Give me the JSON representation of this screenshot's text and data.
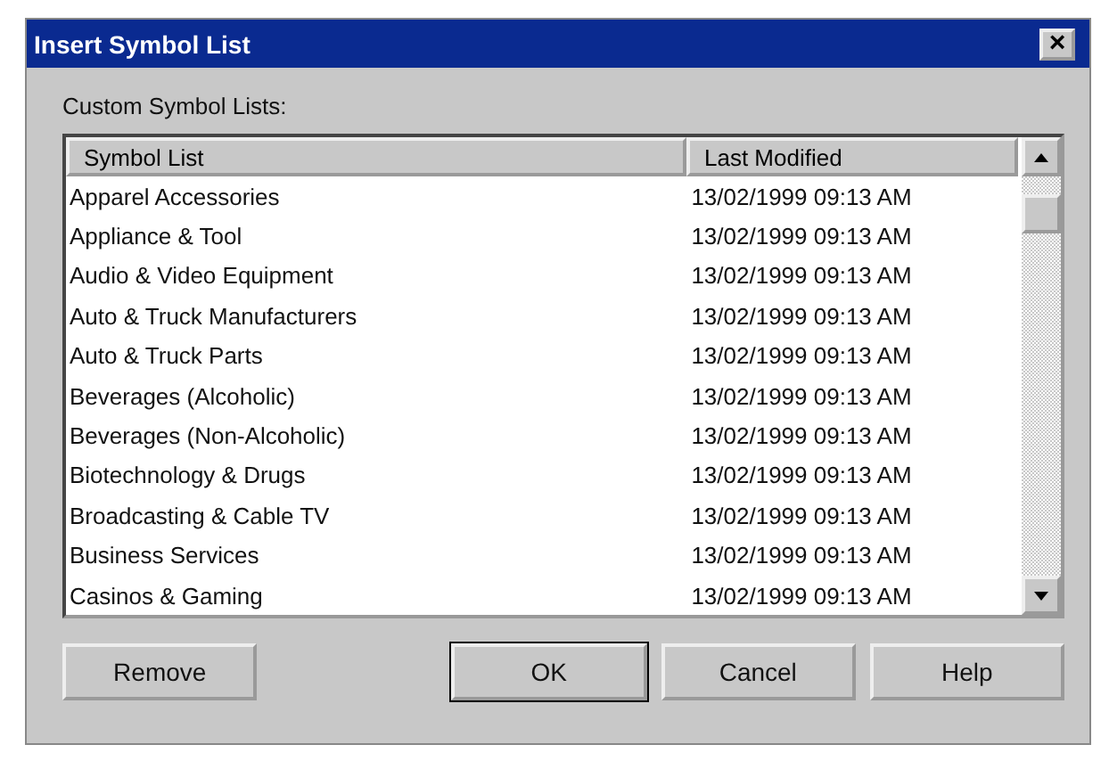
{
  "window": {
    "title": "Insert Symbol List",
    "close": "×"
  },
  "label": "Custom Symbol Lists:",
  "table": {
    "columns": [
      "Symbol List",
      "Last Modified"
    ],
    "rows": [
      [
        "Apparel Accessories",
        "13/02/1999 09:13 AM"
      ],
      [
        "Appliance & Tool",
        "13/02/1999 09:13 AM"
      ],
      [
        "Audio & Video Equipment",
        "13/02/1999 09:13 AM"
      ],
      [
        "Auto & Truck Manufacturers",
        "13/02/1999 09:13 AM"
      ],
      [
        "Auto & Truck Parts",
        "13/02/1999 09:13 AM"
      ],
      [
        "Beverages (Alcoholic)",
        "13/02/1999 09:13 AM"
      ],
      [
        "Beverages (Non-Alcoholic)",
        "13/02/1999 09:13 AM"
      ],
      [
        "Biotechnology & Drugs",
        "13/02/1999 09:13 AM"
      ],
      [
        "Broadcasting & Cable TV",
        "13/02/1999 09:13 AM"
      ],
      [
        "Business Services",
        "13/02/1999 09:13 AM"
      ],
      [
        "Casinos & Gaming",
        "13/02/1999 09:13 AM"
      ]
    ]
  },
  "buttons": [
    {
      "label": "Remove",
      "default": false
    },
    {
      "label": "OK",
      "default": true
    },
    {
      "label": "Cancel",
      "default": false
    },
    {
      "label": "Help",
      "default": false
    }
  ]
}
